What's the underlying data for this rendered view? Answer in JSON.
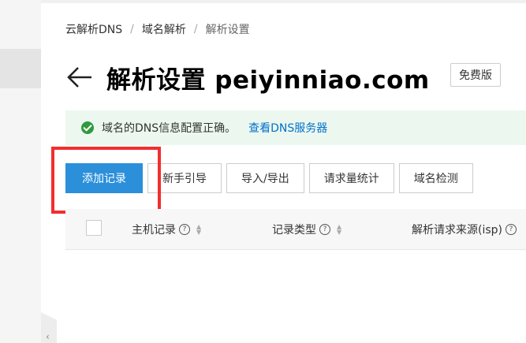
{
  "breadcrumb": {
    "items": [
      "云解析DNS",
      "域名解析",
      "解析设置"
    ],
    "separator": "/"
  },
  "header": {
    "title": "解析设置 peiyinniao.com",
    "badge": "免费版"
  },
  "alert": {
    "message": "域名的DNS信息配置正确。",
    "link": "查看DNS服务器",
    "status_color": "#2f9a3f"
  },
  "toolbar": {
    "add_record": "添加记录",
    "guide": "新手引导",
    "import_export": "导入/导出",
    "stats": "请求量统计",
    "check": "域名检测"
  },
  "table": {
    "columns": [
      "主机记录",
      "记录类型",
      "解析请求来源(isp)"
    ]
  },
  "colors": {
    "primary": "#2b8fda",
    "highlight": "#f22e2e",
    "link": "#0070cc"
  }
}
